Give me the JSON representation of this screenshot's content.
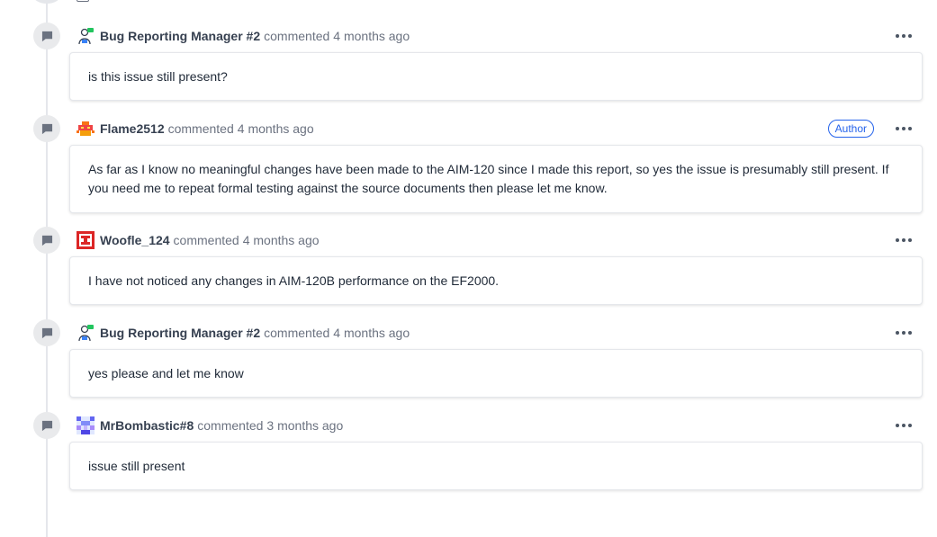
{
  "commented_word": "commented",
  "author_badge": "Author",
  "comments": [
    {
      "author": "Bug Reporting Manager #2",
      "time": "4 months ago",
      "text": "is this issue still present?",
      "avatar": "manager-avatar",
      "is_author": false
    },
    {
      "author": "Flame2512",
      "time": "4 months ago",
      "text": "As far as I know no meaningful changes have been made to the AIM-120 since I made this report, so yes the issue is presumably still present. If you need me to repeat formal testing against the source documents then please let me know.",
      "avatar": "flame-avatar",
      "is_author": true
    },
    {
      "author": "Woofle_124",
      "time": "4 months ago",
      "text": "I have not noticed any changes in AIM-120B performance on the EF2000.",
      "avatar": "woofle-avatar",
      "is_author": false
    },
    {
      "author": "Bug Reporting Manager #2",
      "time": "4 months ago",
      "text": "yes please and let me know",
      "avatar": "manager-avatar",
      "is_author": false
    },
    {
      "author": "MrBombastic#8",
      "time": "3 months ago",
      "text": "issue still present",
      "avatar": "mrbombastic-avatar",
      "is_author": false
    }
  ],
  "colors": {
    "accent": "#2563eb",
    "timeline": "#e5e7eb",
    "node": "#e9eaec"
  }
}
